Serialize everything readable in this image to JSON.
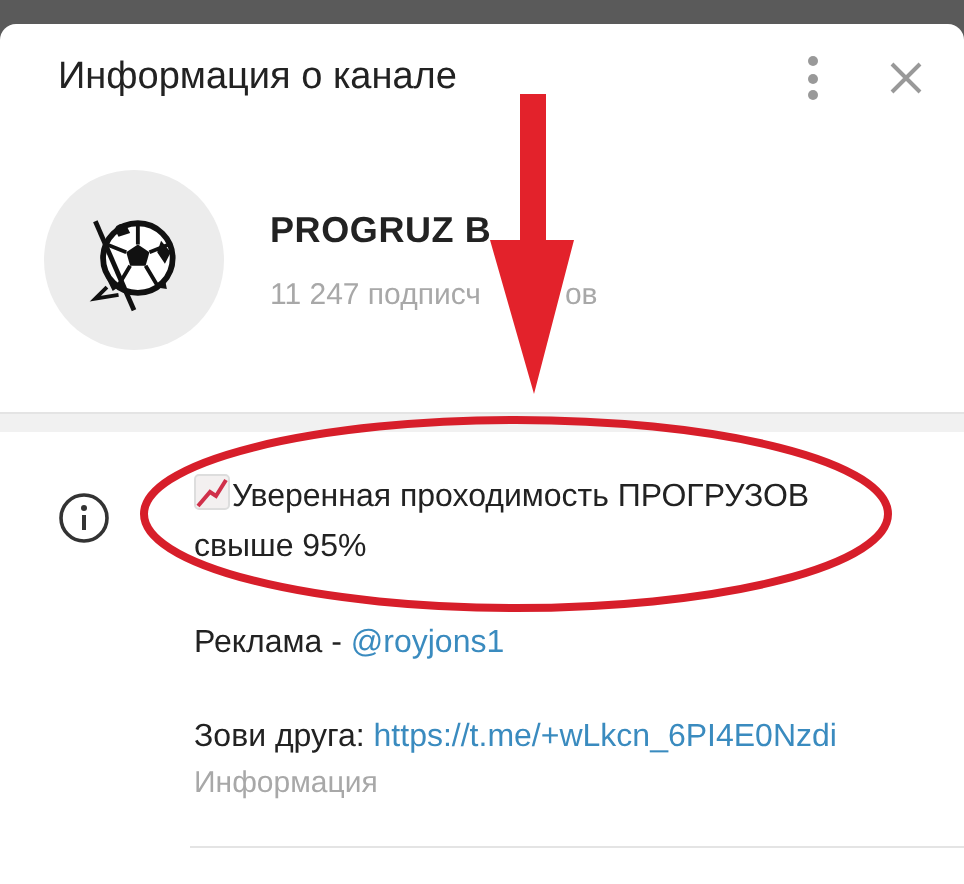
{
  "dialog": {
    "title": "Информация о канале"
  },
  "channel": {
    "name": "PROGRUZ B",
    "subscribers_start": "11 247 подписч",
    "subscribers_end": "ов"
  },
  "description": {
    "lines": [
      "Уверенная проходимость ПРОГРУЗОВ свыше 95%"
    ],
    "ad_label": "Реклама - ",
    "ad_link": "@royjons1",
    "invite_label": "Зови друга: ",
    "invite_link": "https://t.me/+wLkcn_6PI4E0Nzdi",
    "caption": "Информация"
  }
}
